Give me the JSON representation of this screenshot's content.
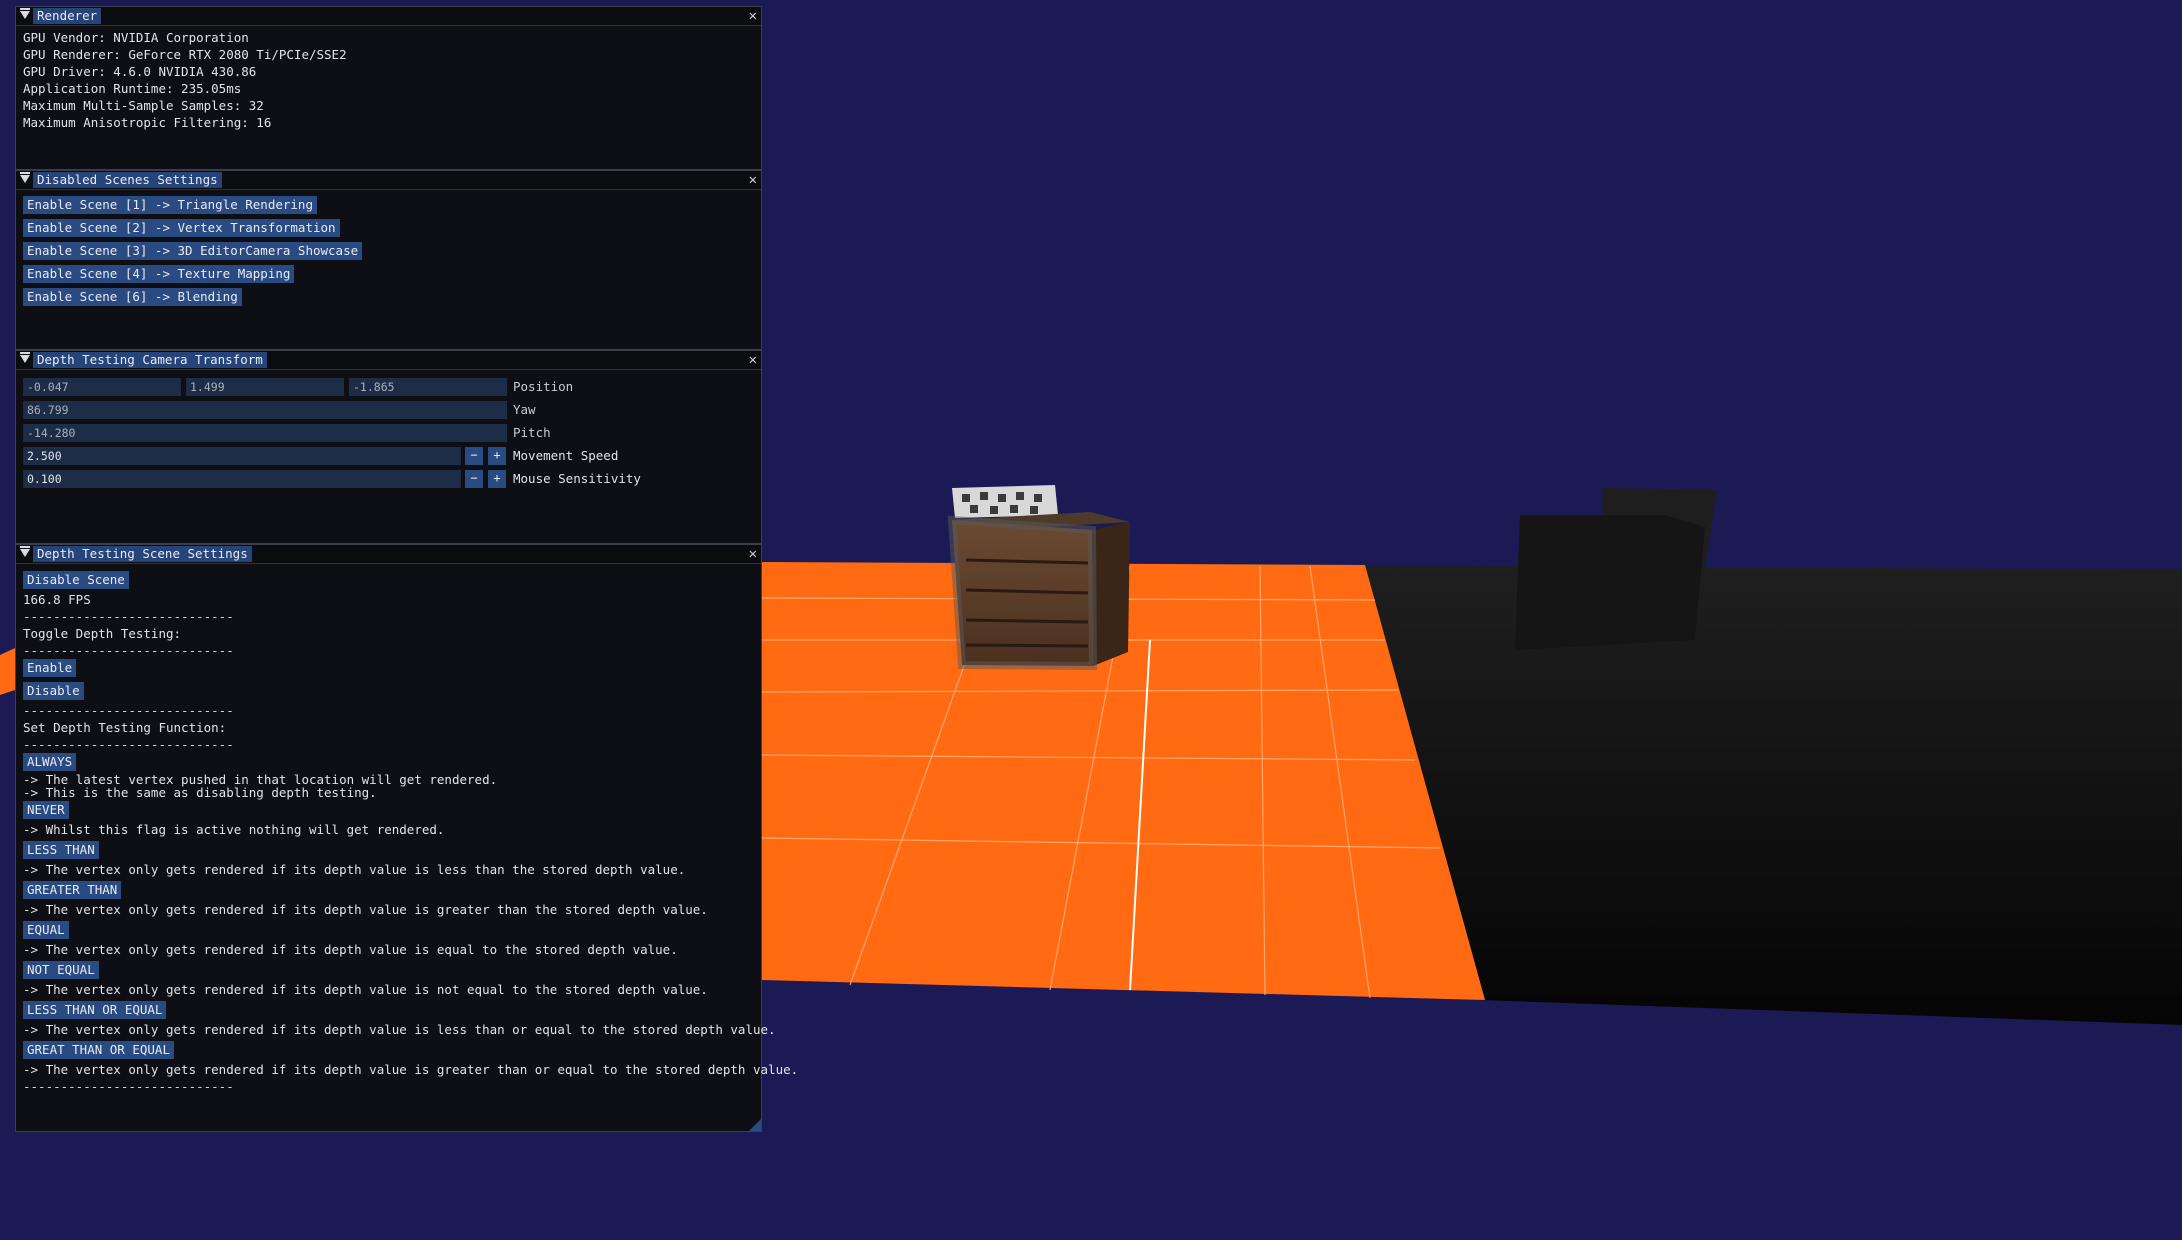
{
  "renderer": {
    "title": "Renderer",
    "lines": [
      "GPU Vendor: NVIDIA Corporation",
      "GPU Renderer: GeForce RTX 2080 Ti/PCIe/SSE2",
      "GPU Driver: 4.6.0 NVIDIA 430.86",
      "Application Runtime: 235.05ms",
      "Maximum Multi-Sample Samples: 32",
      "Maximum Anisotropic Filtering: 16"
    ]
  },
  "disabled_scenes": {
    "title": "Disabled Scenes Settings",
    "buttons": [
      "Enable Scene [1] -> Triangle Rendering",
      "Enable Scene [2] -> Vertex Transformation",
      "Enable Scene [3] -> 3D EditorCamera Showcase",
      "Enable Scene [4] -> Texture Mapping",
      "Enable Scene [6] -> Blending"
    ]
  },
  "camera": {
    "title": "Depth Testing Camera Transform",
    "position": [
      "-0.047",
      "1.499",
      "-1.865"
    ],
    "position_label": "Position",
    "yaw": "86.799",
    "yaw_label": "Yaw",
    "pitch": "-14.280",
    "pitch_label": "Pitch",
    "movement_speed": "2.500",
    "movement_speed_label": "Movement Speed",
    "mouse_sensitivity": "0.100",
    "mouse_sensitivity_label": "Mouse Sensitivity",
    "minus": "−",
    "plus": "+"
  },
  "depth_settings": {
    "title": "Depth Testing Scene Settings",
    "disable_scene": "Disable Scene",
    "fps": "166.8 FPS",
    "separator": "----------------------------",
    "toggle_label": "Toggle Depth Testing:",
    "enable": "Enable",
    "disable": "Disable",
    "function_label": "Set Depth Testing Function:",
    "always": "ALWAYS",
    "always_note1": "-> The latest vertex pushed in that location will get rendered.",
    "always_note2": "-> This is the same as disabling depth testing.",
    "never": "NEVER",
    "never_note": "-> Whilst this flag is active nothing will get rendered.",
    "less": "LESS THAN",
    "less_note": "-> The vertex only gets rendered if its depth value is less than the stored depth value.",
    "greater": "GREATER THAN",
    "greater_note": "-> The vertex only gets rendered if its depth value is greater than the stored depth value.",
    "equal": "EQUAL",
    "equal_note": "-> The vertex only gets rendered if its depth value is equal to the stored depth value.",
    "not_equal": "NOT EQUAL",
    "not_equal_note": "-> The vertex only gets rendered if its depth value is not equal to the stored depth value.",
    "less_equal": "LESS THAN OR EQUAL",
    "less_equal_note": "-> The vertex only gets rendered if its depth value is less than or equal to the stored depth value.",
    "greater_equal": "GREAT THAN OR EQUAL",
    "greater_equal_note": "-> The vertex only gets rendered if its depth value is greater than or equal to the stored depth value."
  },
  "colors": {
    "background": "#1b1a55",
    "floor": "#ff6a12",
    "button": "#2a4a82"
  }
}
